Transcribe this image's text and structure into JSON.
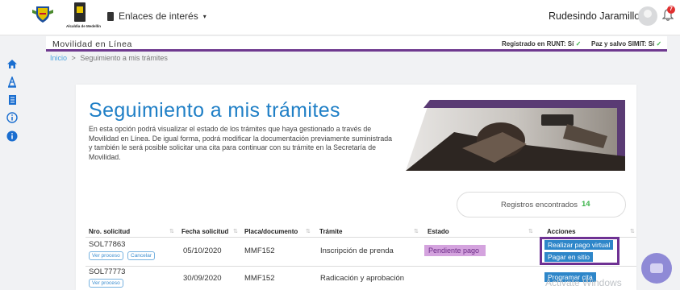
{
  "topbar": {
    "logo_caption": "Alcaldía de Medellín",
    "links_label": "Enlaces de interés",
    "user_name": "Rudesindo Jaramillo",
    "notification_count": "7"
  },
  "subbar": {
    "title": "Movilidad en Línea",
    "runt_label": "Registrado en RUNT: Sí",
    "simit_label": "Paz y salvo SIMIT: Sí"
  },
  "sidebar": {
    "icons": [
      "home-icon",
      "traffic-cone-icon",
      "document-icon",
      "info-icon",
      "info-filled-icon"
    ]
  },
  "breadcrumb": {
    "home": "Inicio",
    "separator": ">",
    "current": "Seguimiento a mis trámites"
  },
  "main": {
    "title": "Seguimiento a mis trámites",
    "description": "En esta opción podrá visualizar el estado de los trámites que haya gestionado a través de Movilidad en Línea. De igual forma, podrá modificar la documentación previamente suministrada y también le será posible solicitar una cita para continuar con su trámite en la Secretaría de Movilidad.",
    "records_label": "Registros encontrados",
    "records_count": "14"
  },
  "table": {
    "columns": [
      "Nro. solicitud",
      "Fecha solicitud",
      "Placa/documento",
      "Trámite",
      "Estado",
      "Acciones"
    ],
    "rows": [
      {
        "solicitud": "SOL77863",
        "tags": [
          "Ver proceso",
          "Cancelar"
        ],
        "fecha": "05/10/2020",
        "placa": "MMF152",
        "tramite": "Inscripción de prenda",
        "estado": "Pendiente pago",
        "acciones": [
          "Realizar pago virtual",
          "Pagar en sitio"
        ]
      },
      {
        "solicitud": "SOL77773",
        "tags": [
          "Ver proceso"
        ],
        "fecha": "30/09/2020",
        "placa": "MMF152",
        "tramite": "Radicación y aprobación",
        "estado": "",
        "acciones": [
          "Programar cita"
        ]
      }
    ]
  },
  "overlay": {
    "watermark": "Activate Windows"
  },
  "colors": {
    "accent_blue": "#1f7fc6",
    "accent_purple": "#6f3a8f",
    "status_pending_bg": "#d4a3de",
    "action_button": "#2e86c9",
    "check_green": "#3cb44b"
  }
}
